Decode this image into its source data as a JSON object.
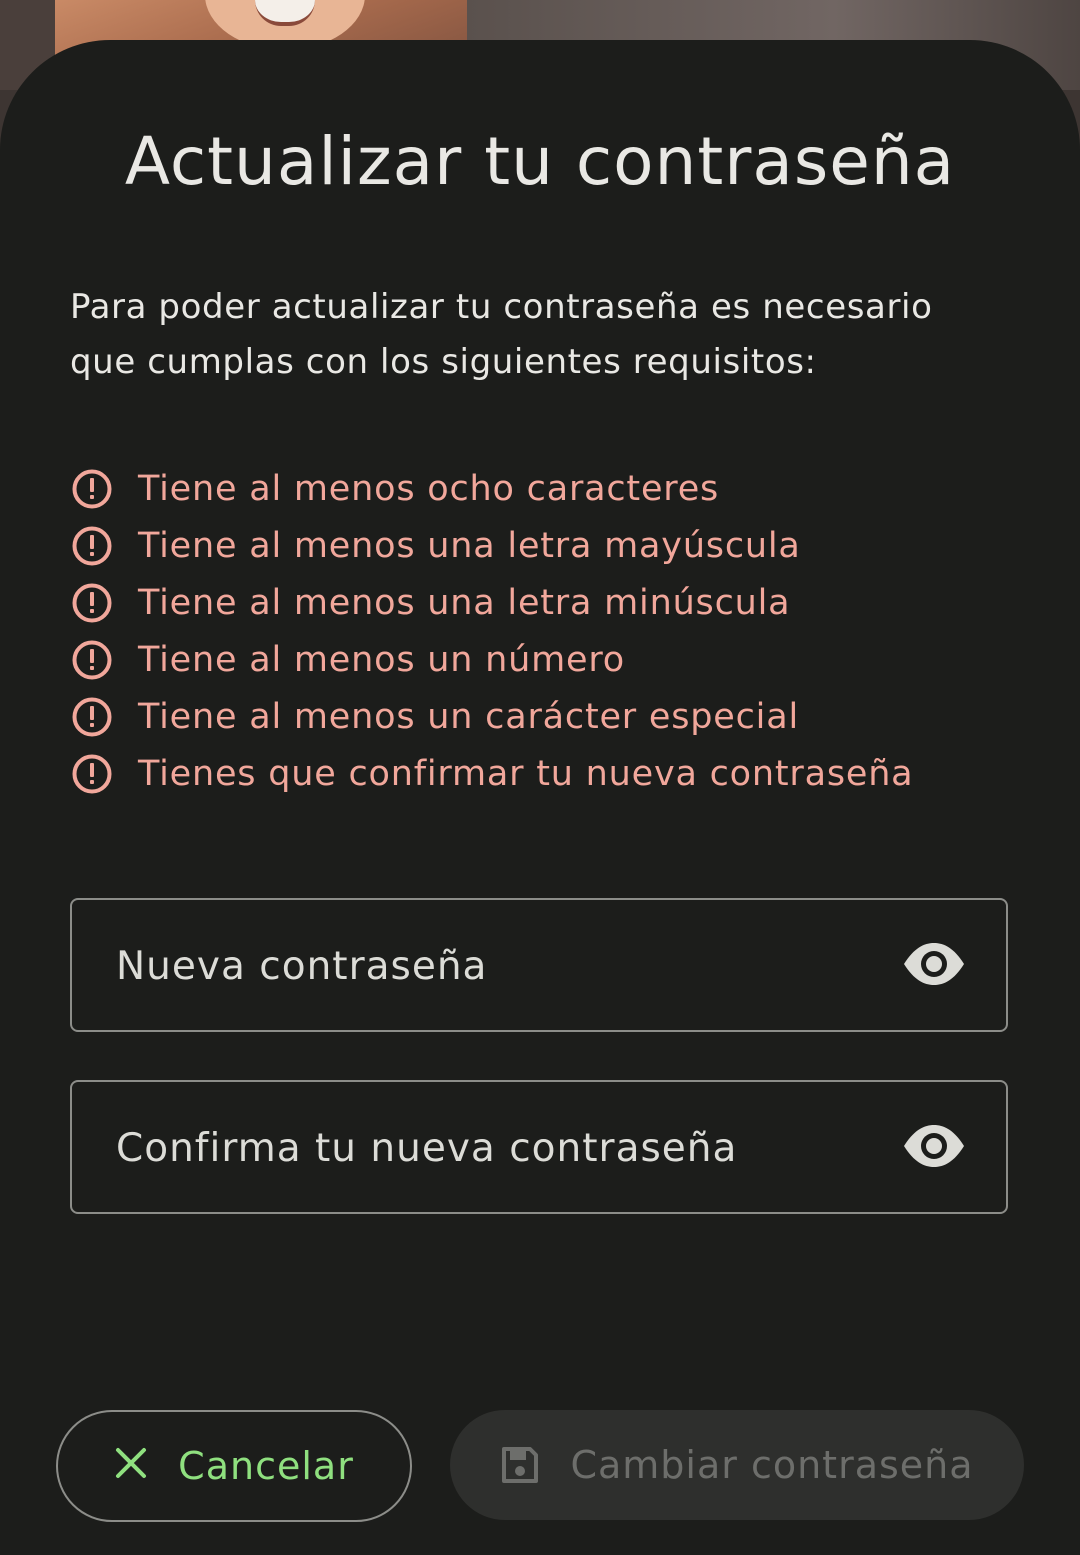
{
  "dialog": {
    "title": "Actualizar tu contraseña",
    "intro": "Para poder actualizar tu contraseña es necesario que cumplas con los siguientes requisitos:",
    "requirements": [
      "Tiene al menos ocho caracteres",
      "Tiene al menos una letra mayúscula",
      "Tiene al menos una letra minúscula",
      "Tiene al menos un número",
      "Tiene al menos un carácter especial",
      "Tienes que confirmar tu nueva contraseña"
    ],
    "new_password": {
      "value": "",
      "placeholder": "Nueva contraseña"
    },
    "confirm_password": {
      "value": "",
      "placeholder": "Confirma tu nueva contraseña"
    },
    "cancel_label": "Cancelar",
    "submit_label": "Cambiar contraseña"
  },
  "icons": {
    "requirement": "alert-circle-icon",
    "visibility": "eye-icon",
    "cancel": "close-icon",
    "submit": "save-icon"
  },
  "colors": {
    "background": "#1c1d1b",
    "text": "#e9e8e4",
    "requirement_error": "#f1a79b",
    "cancel_accent": "#8fe07f",
    "disabled_button_bg": "#2e2f2d",
    "disabled_button_text": "#6d6e6b"
  }
}
